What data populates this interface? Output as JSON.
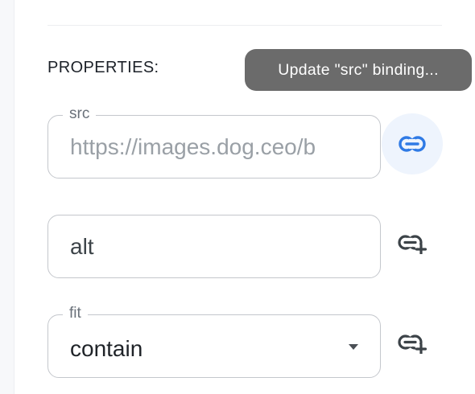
{
  "section": {
    "heading": "PROPERTIES:"
  },
  "tooltip": {
    "text": "Update \"src\" binding..."
  },
  "fields": {
    "src": {
      "label": "src",
      "placeholder": "https://images.dog.ceo/b",
      "icon": "link-icon",
      "icon_color": "#2f7ae5"
    },
    "alt": {
      "value": "alt",
      "icon": "link-add-icon",
      "icon_color": "#3c4348"
    },
    "fit": {
      "label": "fit",
      "value": "contain",
      "icon": "link-add-icon",
      "icon_color": "#3c4348"
    }
  }
}
